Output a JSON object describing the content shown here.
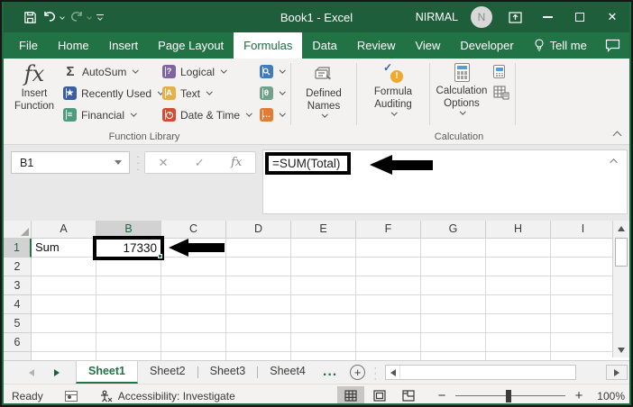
{
  "titlebar": {
    "title": "Book1 - Excel",
    "user": "NIRMAL",
    "avatar_initial": "N"
  },
  "tabs": [
    "File",
    "Home",
    "Insert",
    "Page Layout",
    "Formulas",
    "Data",
    "Review",
    "View",
    "Developer",
    "Tell me"
  ],
  "ribbon": {
    "insert_function": "Insert Function",
    "autosum": "AutoSum",
    "recently_used": "Recently Used",
    "financial": "Financial",
    "logical": "Logical",
    "text": "Text",
    "date_time": "Date & Time",
    "defined_names": "Defined Names",
    "formula_auditing": "Formula Auditing",
    "calculation_options": "Calculation Options",
    "group_function_library": "Function Library",
    "group_calculation": "Calculation"
  },
  "formula_bar": {
    "name_box": "B1",
    "formula": "=SUM(Total)"
  },
  "grid": {
    "columns": [
      "A",
      "B",
      "C",
      "D",
      "E",
      "F",
      "G",
      "H",
      "I"
    ],
    "rows": [
      "1",
      "2",
      "3",
      "4",
      "5",
      "6"
    ],
    "a1": "Sum",
    "b1": "17330"
  },
  "sheetbar": {
    "sheets": [
      "Sheet1",
      "Sheet2",
      "Sheet3",
      "Sheet4"
    ],
    "more": "..."
  },
  "statusbar": {
    "ready": "Ready",
    "accessibility": "Accessibility: Investigate",
    "zoom": "100%"
  },
  "colors": {
    "accent_green": "#217346",
    "titlebar_green": "#1e5e3a",
    "annotation": "#000000"
  }
}
